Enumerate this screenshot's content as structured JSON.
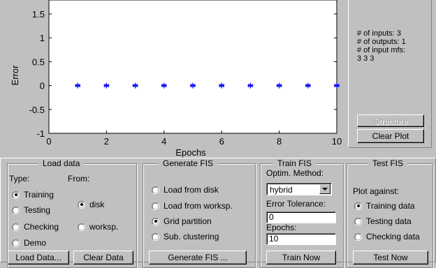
{
  "plot": {
    "ylabel": "Error",
    "xlabel": "Epochs",
    "x_ticks": [
      "0",
      "2",
      "4",
      "6",
      "8",
      "10"
    ],
    "y_ticks": [
      "1.5",
      "1",
      "0.5",
      "0",
      "-0.5",
      "-1"
    ],
    "marker_color": "#0000ff"
  },
  "chart_data": {
    "type": "scatter",
    "x": [
      1,
      2,
      3,
      4,
      5,
      6,
      7,
      8,
      9,
      10
    ],
    "y": [
      0,
      0,
      0,
      0,
      0,
      0,
      0,
      0,
      0,
      0
    ],
    "xlim": [
      0,
      10
    ],
    "ylim": [
      -1,
      1.5
    ],
    "xlabel": "Epochs",
    "ylabel": "Error",
    "marker": "*"
  },
  "info": {
    "inputs": "# of inputs: 3",
    "outputs": "# of outputs: 1",
    "input_mfs": "# of input mfs:",
    "mfs_values": "3  3  3",
    "structure_label": "Structure",
    "clear_plot_label": "Clear Plot"
  },
  "load_data": {
    "title": "Load data",
    "type_label": "Type:",
    "from_label": "From:",
    "types": [
      "Training",
      "Testing",
      "Checking",
      "Demo"
    ],
    "sources": [
      "disk",
      "worksp."
    ],
    "load_button": "Load Data...",
    "clear_button": "Clear Data"
  },
  "generate_fis": {
    "title": "Generate FIS",
    "options": [
      "Load from disk",
      "Load from worksp.",
      "Grid partition",
      "Sub. clustering"
    ],
    "button": "Generate FIS ..."
  },
  "train_fis": {
    "title": "Train FIS",
    "method_label": "Optim. Method:",
    "method_value": "hybrid",
    "tolerance_label": "Error Tolerance:",
    "tolerance_value": "0",
    "epochs_label": "Epochs:",
    "epochs_value": "10",
    "button": "Train Now"
  },
  "test_fis": {
    "title": "Test FIS",
    "plot_against_label": "Plot against:",
    "options": [
      "Training data",
      "Testing data",
      "Checking data"
    ],
    "button": "Test Now"
  }
}
